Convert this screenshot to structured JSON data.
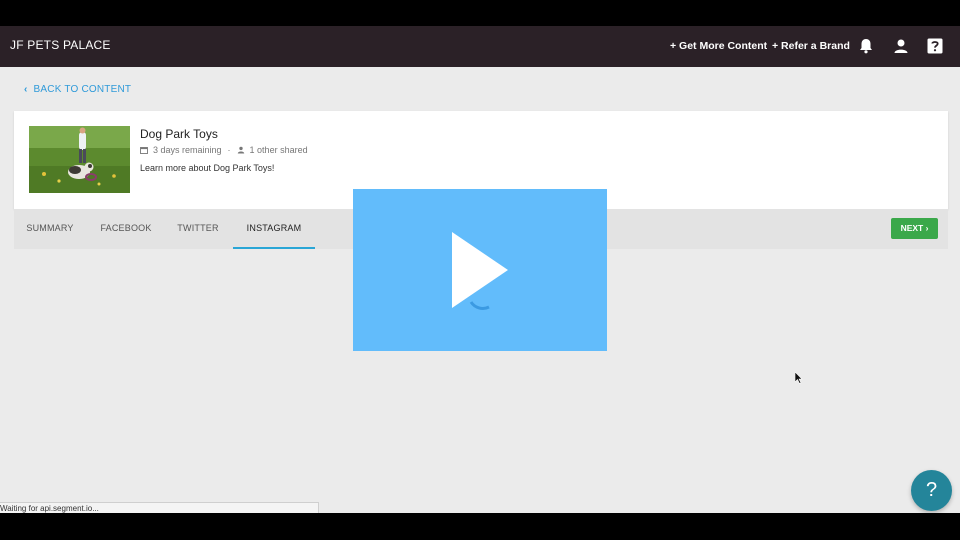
{
  "navbar": {
    "brand": "JF PETS PALACE",
    "links": [
      "+ Get More Content",
      "+ Refer a Brand"
    ],
    "icons": [
      "bell-icon",
      "user-icon",
      "help-icon"
    ]
  },
  "back_link": "BACK TO CONTENT",
  "content": {
    "title": "Dog Park Toys",
    "days_remaining": "3 days remaining",
    "shared": "1 other shared",
    "description": "Learn more about Dog Park Toys!"
  },
  "tabs": {
    "items": [
      "SUMMARY",
      "FACEBOOK",
      "TWITTER",
      "INSTAGRAM"
    ],
    "active": "INSTAGRAM",
    "next_label": "NEXT ›"
  },
  "status_bar": "Waiting for api.segment.io...",
  "help_fab": "?",
  "colors": {
    "navbar": "#2b2127",
    "accent_blue": "#2f9ad9",
    "next_button": "#3aa84a",
    "video_overlay": "#62bcfb",
    "help_fab": "#24859a"
  }
}
